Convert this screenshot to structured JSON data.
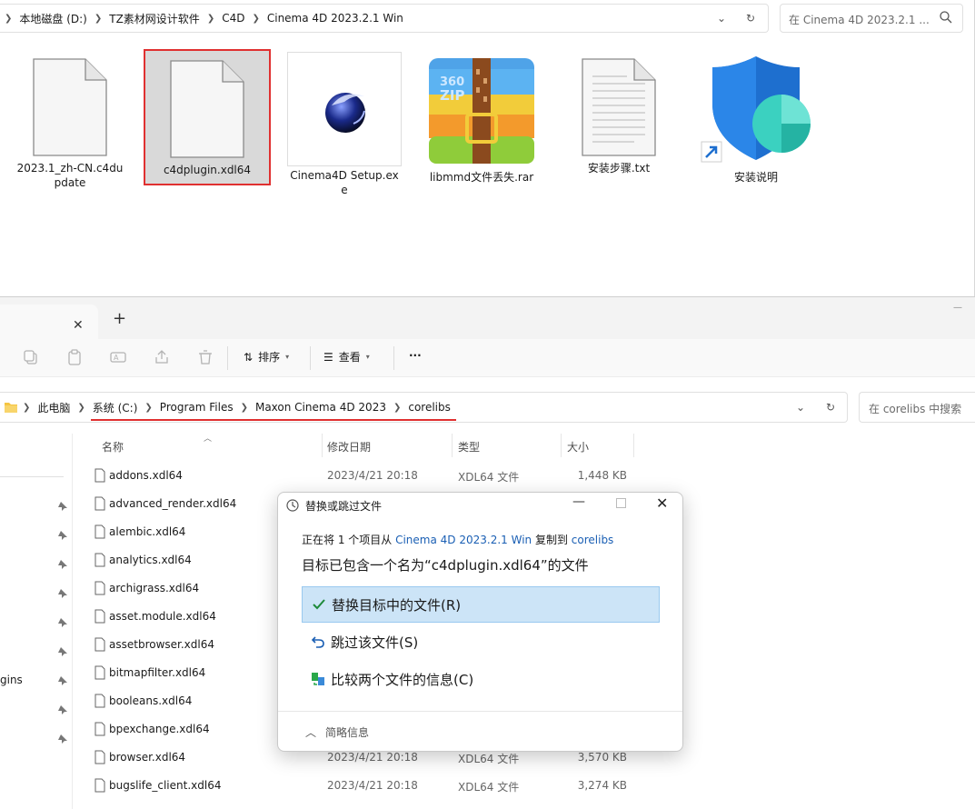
{
  "top_window": {
    "breadcrumbs": [
      "本地磁盘 (D:)",
      "TZ素材网设计软件",
      "C4D",
      "Cinema 4D 2023.2.1 Win"
    ],
    "search_placeholder": "在 Cinema 4D 2023.2.1 ...",
    "files": [
      {
        "name": "2023.1_zh-CN.c4dupdate",
        "icon": "blank-file-icon"
      },
      {
        "name": "c4dplugin.xdl64",
        "icon": "blank-file-icon",
        "selected": true
      },
      {
        "name": "Cinema4D Setup.exe",
        "icon": "cinema4d-icon"
      },
      {
        "name": "libmmd文件丢失.rar",
        "icon": "360zip-archive-icon",
        "icon_text": "360\nZIP"
      },
      {
        "name": "安装步骤.txt",
        "icon": "text-file-icon"
      },
      {
        "name": "安装说明",
        "icon": "shortcut-shield-icon"
      }
    ]
  },
  "bottom_window": {
    "toolbar": {
      "sort_label": "排序",
      "view_label": "查看",
      "more_label": "···"
    },
    "breadcrumbs": [
      "此电脑",
      "系统 (C:)",
      "Program Files",
      "Maxon Cinema 4D 2023",
      "corelibs"
    ],
    "search_placeholder": "在 corelibs 中搜索",
    "nav_partial_label": "gins",
    "columns": {
      "name": "名称",
      "modified": "修改日期",
      "type": "类型",
      "size": "大小"
    },
    "rows": [
      {
        "name": "addons.xdl64",
        "date": "2023/4/21 20:18",
        "type": "XDL64 文件",
        "size": "1,448 KB"
      },
      {
        "name": "advanced_render.xdl64"
      },
      {
        "name": "alembic.xdl64"
      },
      {
        "name": "analytics.xdl64"
      },
      {
        "name": "archigrass.xdl64"
      },
      {
        "name": "asset.module.xdl64"
      },
      {
        "name": "assetbrowser.xdl64"
      },
      {
        "name": "bitmapfilter.xdl64"
      },
      {
        "name": "booleans.xdl64"
      },
      {
        "name": "bpexchange.xdl64"
      },
      {
        "name": "browser.xdl64",
        "date": "2023/4/21 20:18",
        "type": "XDL64 文件",
        "size": "3,570 KB"
      },
      {
        "name": "bugslife_client.xdl64",
        "date": "2023/4/21 20:18",
        "type": "XDL64 文件",
        "size": "3,274 KB"
      }
    ]
  },
  "dialog": {
    "title": "替换或跳过文件",
    "line1_prefix": "正在将 1 个项目从 ",
    "line1_source": "Cinema 4D 2023.2.1 Win",
    "line1_mid": " 复制到 ",
    "line1_dest": "corelibs",
    "heading": "目标已包含一个名为“c4dplugin.xdl64”的文件",
    "options": {
      "replace": "替换目标中的文件(R)",
      "skip": "跳过该文件(S)",
      "compare": "比较两个文件的信息(C)"
    },
    "more_info": "简略信息"
  },
  "colors": {
    "highlight_red": "#e03030",
    "link_blue": "#1a5fb4",
    "option_selected": "#cce4f7"
  }
}
